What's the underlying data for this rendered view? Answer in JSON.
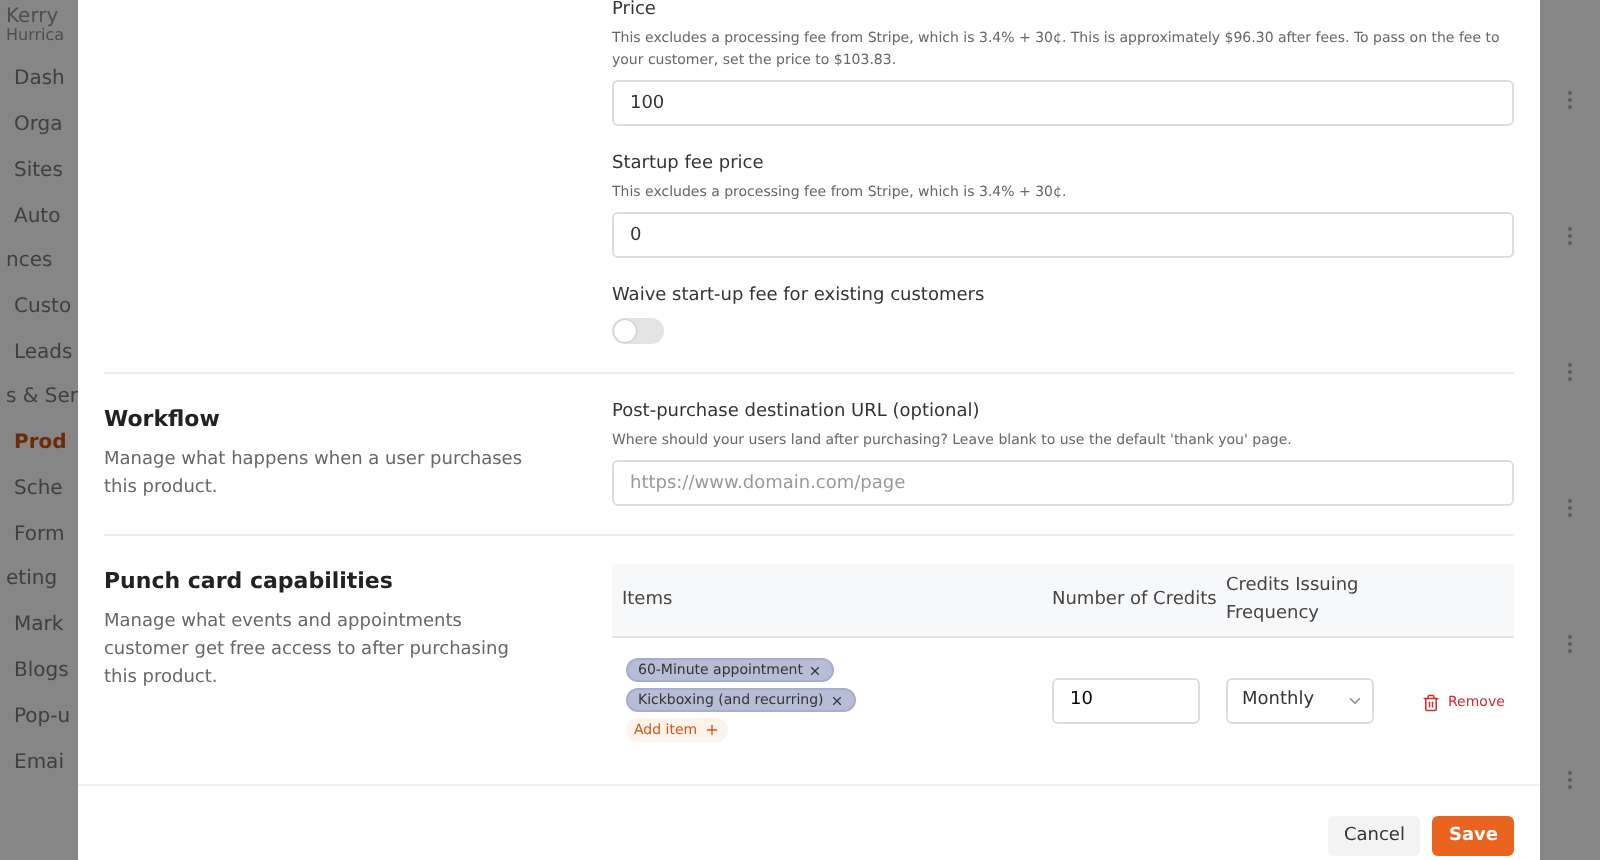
{
  "background_sidebar": {
    "user_name": "Kerry",
    "org_name": "Hurrica",
    "items": [
      {
        "label": "Dash",
        "kind": "item",
        "selected": false
      },
      {
        "label": "Orga",
        "kind": "item",
        "selected": false
      },
      {
        "label": "Sites",
        "kind": "item",
        "selected": false
      },
      {
        "label": "Auto",
        "kind": "item",
        "selected": false
      },
      {
        "label": "nces",
        "kind": "heading"
      },
      {
        "label": "Custo",
        "kind": "item",
        "selected": false
      },
      {
        "label": "Leads",
        "kind": "item",
        "selected": false
      },
      {
        "label": "s & Ser",
        "kind": "heading"
      },
      {
        "label": "Prod",
        "kind": "item",
        "selected": true
      },
      {
        "label": "Sche",
        "kind": "item",
        "selected": false
      },
      {
        "label": "Form",
        "kind": "item",
        "selected": false
      },
      {
        "label": "eting",
        "kind": "heading"
      },
      {
        "label": "Mark",
        "kind": "item",
        "selected": false
      },
      {
        "label": "Blogs",
        "kind": "item",
        "selected": false
      },
      {
        "label": "Pop-u",
        "kind": "item",
        "selected": false
      },
      {
        "label": "Emai",
        "kind": "item",
        "selected": false
      }
    ]
  },
  "pricing": {
    "price": {
      "label": "Price",
      "hint": "This excludes a processing fee from Stripe, which is 3.4% + 30¢. This is approximately $96.30 after fees. To pass on the fee to your customer, set the price to $103.83.",
      "value": "100"
    },
    "startup_fee": {
      "label": "Startup fee price",
      "hint": "This excludes a processing fee from Stripe, which is 3.4% + 30¢.",
      "value": "0"
    },
    "waive_fee": {
      "label": "Waive start-up fee for existing customers",
      "on": false
    }
  },
  "workflow": {
    "title": "Workflow",
    "description": "Manage what happens when a user purchases this product.",
    "field_label": "Post-purchase destination URL (optional)",
    "field_hint": "Where should your users land after purchasing? Leave blank to use the default 'thank you' page.",
    "placeholder": "https://www.domain.com/page"
  },
  "punch_card": {
    "title": "Punch card capabilities",
    "description": "Manage what events and appointments customer get free access to after purchasing this product.",
    "columns": [
      "Items",
      "Number of Credits",
      "Credits Issuing Frequency"
    ],
    "rows": [
      {
        "items": [
          "60-Minute appointment",
          "Kickboxing (and recurring)"
        ],
        "add_item": "Add item",
        "credits": "10",
        "frequency": "Monthly",
        "remove": "Remove"
      }
    ]
  },
  "footer": {
    "cancel": "Cancel",
    "save": "Save"
  }
}
